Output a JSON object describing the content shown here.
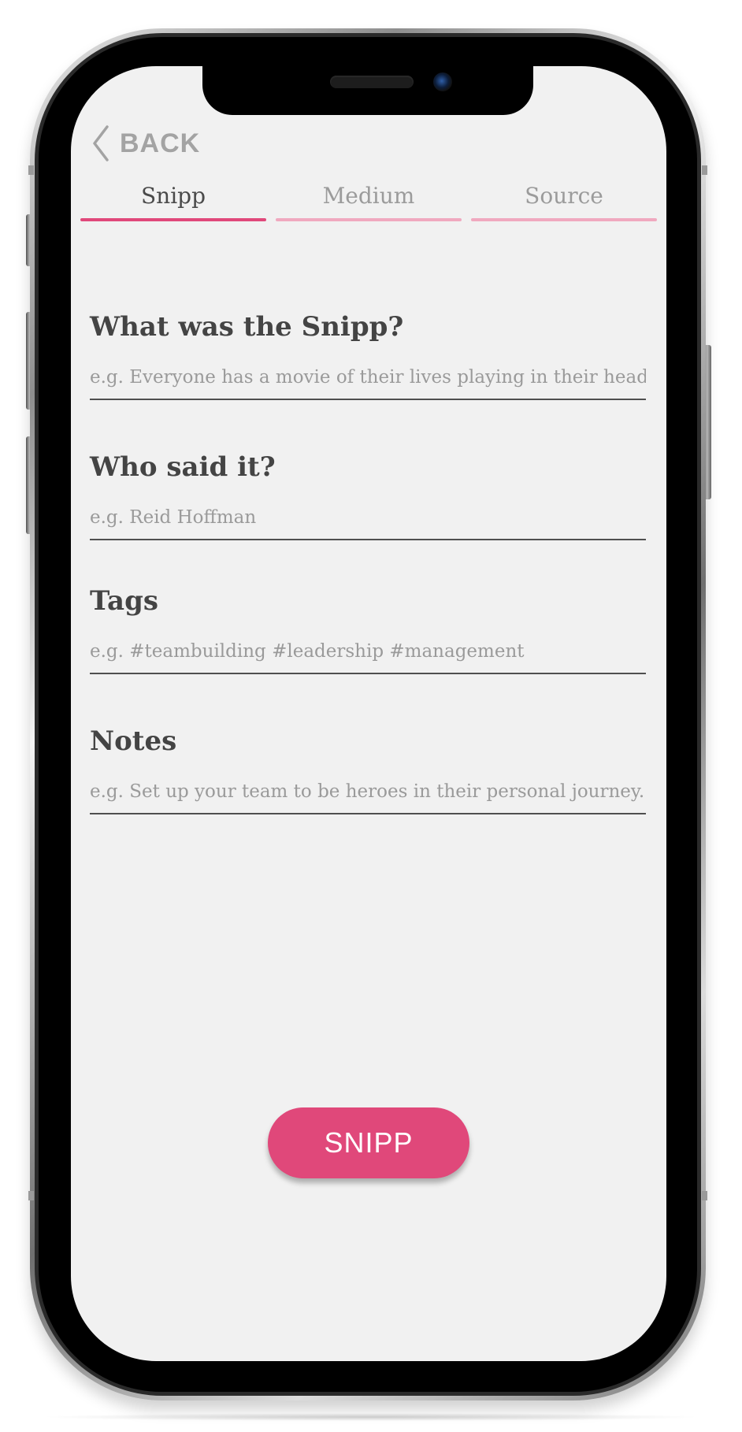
{
  "header": {
    "back_label": "BACK",
    "back_icon": "chevron-left-icon"
  },
  "tabs": [
    {
      "label": "Snipp",
      "active": true
    },
    {
      "label": "Medium",
      "active": false
    },
    {
      "label": "Source",
      "active": false
    }
  ],
  "form": {
    "snipp": {
      "label": "What was the Snipp?",
      "value": "",
      "placeholder": "e.g. Everyone has a movie of their lives playing in their head."
    },
    "who": {
      "label": "Who said it?",
      "value": "",
      "placeholder": "e.g. Reid Hoffman"
    },
    "tags": {
      "label": "Tags",
      "value": "",
      "placeholder": "e.g. #teambuilding #leadership #management"
    },
    "notes": {
      "label": "Notes",
      "value": "",
      "placeholder": "e.g. Set up your team to be heroes in their personal journey."
    }
  },
  "actions": {
    "submit_label": "SNIPP"
  },
  "colors": {
    "accent": "#e0487a",
    "accent_light": "#f0a9bf",
    "screen_background": "#f1f1f1",
    "label_text": "#444444",
    "muted_text": "#9b9b9b"
  }
}
